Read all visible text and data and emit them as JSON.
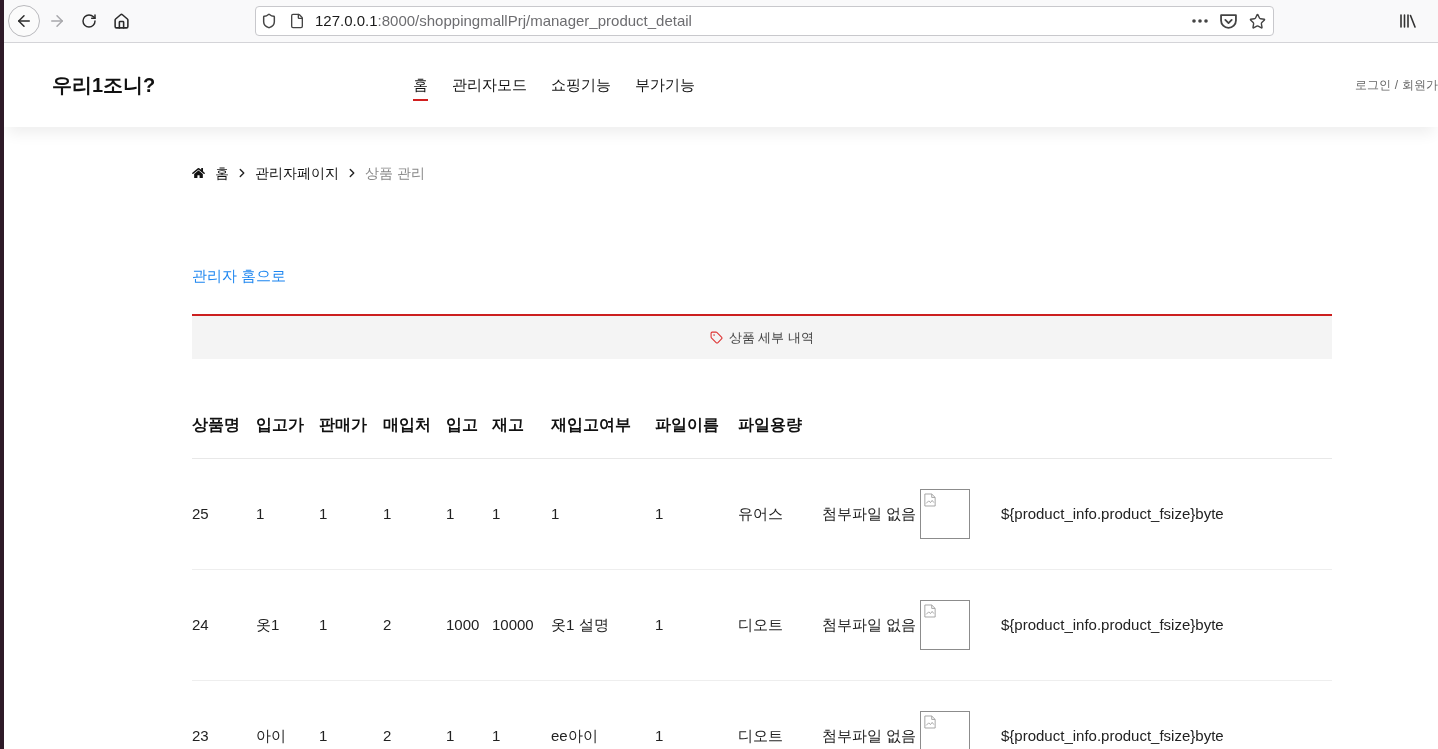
{
  "browser": {
    "forward_disabled": true,
    "url_host": "127.0.0.1",
    "url_path": ":8000/shoppingmallPrj/manager_product_detail"
  },
  "header": {
    "logo": "우리1조니?",
    "nav": [
      {
        "label": "홈",
        "selected": true
      },
      {
        "label": "관리자모드",
        "selected": false
      },
      {
        "label": "쇼핑기능",
        "selected": false
      },
      {
        "label": "부가기능",
        "selected": false
      }
    ],
    "auth_links": [
      "로그인",
      "회원가"
    ],
    "auth_separator": "/"
  },
  "breadcrumb": [
    {
      "label": "홈",
      "current": false
    },
    {
      "label": "관리자페이지",
      "current": false
    },
    {
      "label": "상품 관리",
      "current": true
    }
  ],
  "back_link": "관리자 홈으로",
  "section_title": "상품 세부 내역",
  "table": {
    "columns": [
      "상품명",
      "입고가",
      "판매가",
      "매입처",
      "입고",
      "재고",
      "재입고여부",
      "파일이름",
      "파일용량"
    ],
    "rows": [
      {
        "cells": [
          "25",
          "1",
          "1",
          "1",
          "1",
          "1",
          "1",
          "1",
          "유어스"
        ],
        "file_note": "첨부파일 없음",
        "file_size": "${product_info.product_fsize}byte"
      },
      {
        "cells": [
          "24",
          "옷1",
          "1",
          "2",
          "1000",
          "10000",
          "옷1 설명",
          "1",
          "디오트"
        ],
        "file_note": "첨부파일 없음",
        "file_size": "${product_info.product_fsize}byte"
      },
      {
        "cells": [
          "23",
          "아이",
          "1",
          "2",
          "1",
          "1",
          "ee아이",
          "1",
          "디오트"
        ],
        "file_note": "첨부파일 없음",
        "file_size": "${product_info.product_fsize}byte"
      }
    ]
  }
}
